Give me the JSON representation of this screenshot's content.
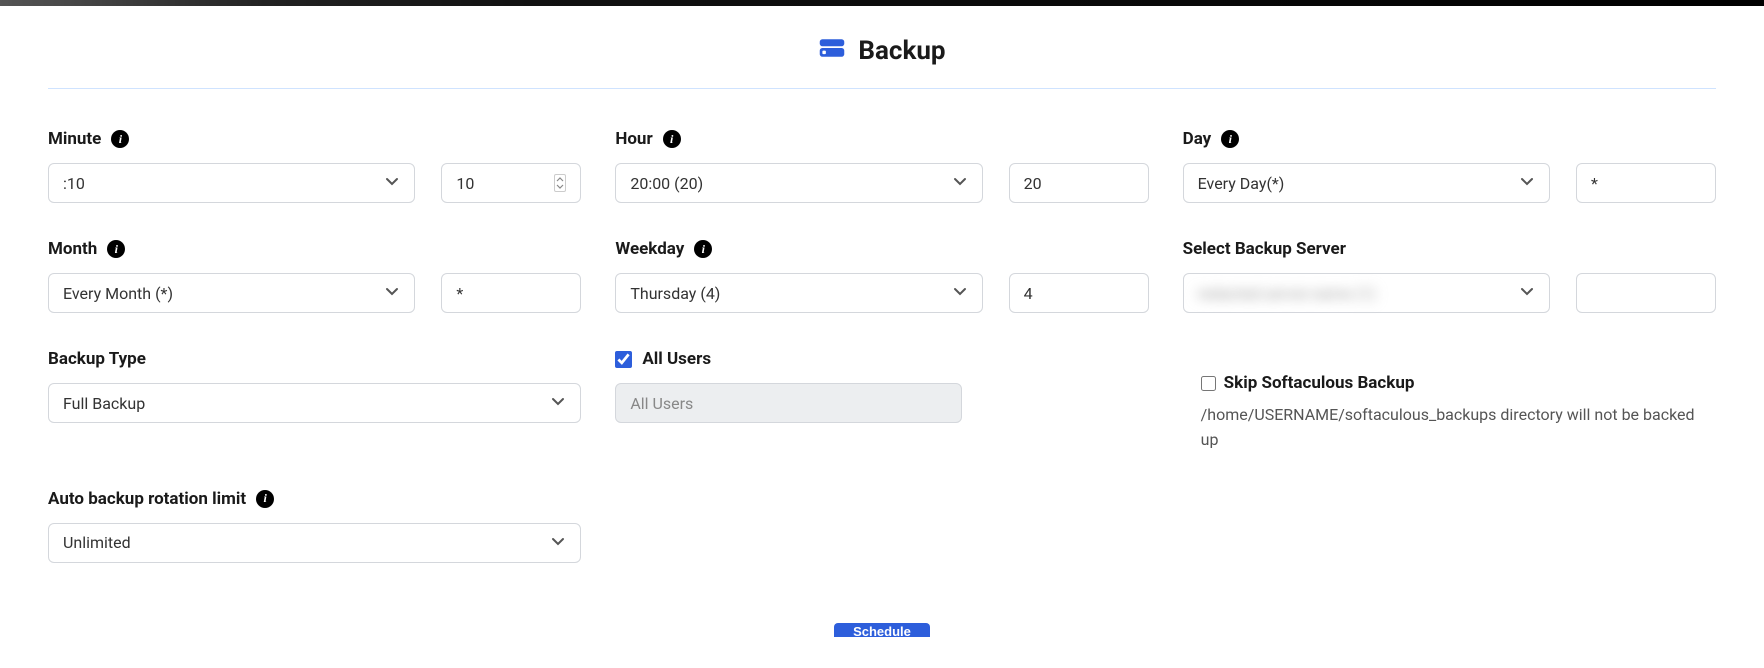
{
  "title": "Backup",
  "fields": {
    "minute": {
      "label": "Minute",
      "select": ":10",
      "value": "10"
    },
    "hour": {
      "label": "Hour",
      "select": "20:00 (20)",
      "value": "20"
    },
    "day": {
      "label": "Day",
      "select": "Every Day(*)",
      "value": "*"
    },
    "month": {
      "label": "Month",
      "select": "Every Month (*)",
      "value": "*"
    },
    "weekday": {
      "label": "Weekday",
      "select": "Thursday (4)",
      "value": "4"
    },
    "server": {
      "label": "Select Backup Server",
      "select": "",
      "value": ""
    },
    "backup_type": {
      "label": "Backup Type",
      "select": "Full Backup"
    },
    "all_users": {
      "label": "All Users",
      "checked": true,
      "disabled_input": "All Users"
    },
    "rotation": {
      "label": "Auto backup rotation limit",
      "select": "Unlimited"
    },
    "skip": {
      "label": "Skip Softaculous Backup",
      "checked": false,
      "desc": "/home/USERNAME/softaculous_backups directory will not be backed up"
    }
  },
  "submit_label": "Schedule"
}
